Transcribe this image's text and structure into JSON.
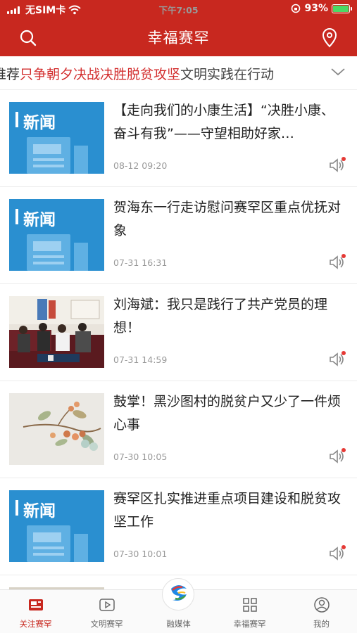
{
  "status_bar": {
    "carrier": "无SIM卡",
    "time": "下午7:05",
    "battery": "93%"
  },
  "header": {
    "title": "幸福赛罕",
    "search_icon": "search-icon",
    "location_icon": "location-pin-icon",
    "bg_color": "#c8281f"
  },
  "ticker": {
    "prefix": "推荐",
    "highlight": "只争朝夕决战决胜脱贫攻坚",
    "suffix": "文明实践在行动"
  },
  "news": [
    {
      "title": "【走向我们的小康生活】“决胜小康、奋斗有我”——守望相助好家…",
      "time": "08-12 09:20",
      "thumb_label": "新闻",
      "thumb_type": "news"
    },
    {
      "title": "贺海东一行走访慰问赛罕区重点优抚对象",
      "time": "07-31 16:31",
      "thumb_label": "新闻",
      "thumb_type": "news"
    },
    {
      "title": "刘海斌：我只是践行了共产党员的理想！",
      "time": "07-31 14:59",
      "thumb_label": "",
      "thumb_type": "photo"
    },
    {
      "title": "鼓掌！黑沙图村的脱贫户又少了一件烦心事",
      "time": "07-30 10:05",
      "thumb_label": "",
      "thumb_type": "painting"
    },
    {
      "title": "赛罕区扎实推进重点项目建设和脱贫攻坚工作",
      "time": "07-30 10:01",
      "thumb_label": "新闻",
      "thumb_type": "news"
    }
  ],
  "tabs": [
    {
      "label": "关注赛罕",
      "icon": "news-icon",
      "active": true
    },
    {
      "label": "文明赛罕",
      "icon": "play-icon",
      "active": false
    },
    {
      "label": "融媒体",
      "icon": "media-logo-icon",
      "active": false
    },
    {
      "label": "幸福赛罕",
      "icon": "grid-icon",
      "active": false
    },
    {
      "label": "我的",
      "icon": "user-icon",
      "active": false
    }
  ],
  "colors": {
    "accent": "#c8281f",
    "news_blue": "#2a8fd0",
    "highlight_red": "#d32f2f"
  }
}
